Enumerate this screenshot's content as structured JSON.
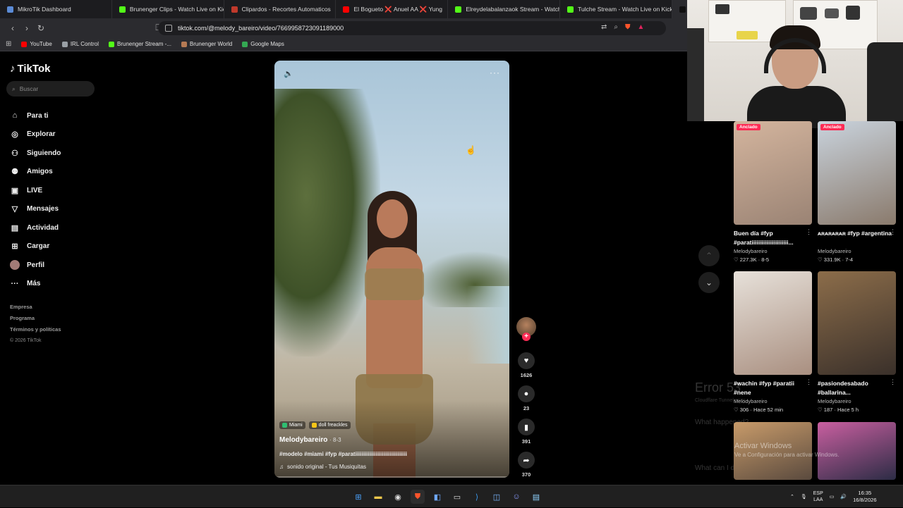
{
  "browser": {
    "tabs": [
      {
        "label": "MikroTik Dashboard",
        "color": "#5b8bd6"
      },
      {
        "label": "Brunenger Clips - Watch Live on Kick",
        "color": "#53fc18"
      },
      {
        "label": "Clipardos - Recortes Automaticos",
        "color": "#c0392b"
      },
      {
        "label": "El Bogueto ❌ Anuel AA ❌ Yung",
        "color": "#ff0000"
      },
      {
        "label": "Elreydelabalanzaok Stream - Watch",
        "color": "#53fc18"
      },
      {
        "label": "Tulche Stream - Watch Live on Kick",
        "color": "#53fc18"
      },
      {
        "label": "d",
        "color": "#111111"
      }
    ],
    "url": "tiktok.com/@melody_bareiro/video/7669958723091189000",
    "bookmarks": [
      {
        "label": "YouTube",
        "color": "#ff0000"
      },
      {
        "label": "IRL Control",
        "color": "#9aa0a6"
      },
      {
        "label": "Brunenger Stream -...",
        "color": "#53fc18"
      },
      {
        "label": "Brunenger World",
        "color": "#b57a54"
      },
      {
        "label": "Google Maps",
        "color": "#34a853"
      }
    ]
  },
  "tiktok": {
    "logo": "TikTok",
    "search_placeholder": "Buscar",
    "nav": [
      {
        "label": "Para ti",
        "icon": "home-icon",
        "glyph": "⌂"
      },
      {
        "label": "Explorar",
        "icon": "compass-icon",
        "glyph": "◎"
      },
      {
        "label": "Siguiendo",
        "icon": "following-icon",
        "glyph": "⚇"
      },
      {
        "label": "Amigos",
        "icon": "friends-icon",
        "glyph": "⚉"
      },
      {
        "label": "LIVE",
        "icon": "live-icon",
        "glyph": "▣"
      },
      {
        "label": "Mensajes",
        "icon": "messages-icon",
        "glyph": "▽"
      },
      {
        "label": "Actividad",
        "icon": "activity-icon",
        "glyph": "▤"
      },
      {
        "label": "Cargar",
        "icon": "upload-icon",
        "glyph": "⊞"
      },
      {
        "label": "Perfil",
        "icon": "avatar-icon",
        "glyph": ""
      },
      {
        "label": "Más",
        "icon": "more-icon",
        "glyph": "···"
      }
    ],
    "footer": [
      "Empresa",
      "Programa",
      "Términos y políticas"
    ],
    "copyright": "© 2026 TikTok",
    "video": {
      "tags": [
        {
          "label": "Miami",
          "color": "#2fbf71"
        },
        {
          "label": "doll freackles",
          "color": "#f5c518"
        }
      ],
      "author": "Melodybareiro",
      "date": "· 8-3",
      "description": "#modelo #miami #fyp #paratiiiiiiiiiiiiiiiiiiiiiiiiiiiiiiiii",
      "sound": "sonido original - Tus Musiquitas",
      "progress": 0.0
    },
    "actions": {
      "likes": "1626",
      "comments": "23",
      "saves": "391",
      "shares": "370"
    },
    "grid": [
      {
        "badge": "Anclado",
        "title": "Buen día #fyp #paratiiiiiiiiiiiiiiiiiiiiii...",
        "author": "Melodybareiro",
        "stats": "♡ 227.3K · 8-5",
        "c1": "#9a8374",
        "c2": "#d4b59e"
      },
      {
        "badge": "Anclado",
        "title": "ᴀʀᴀʀᴀʀᴀʀ #fyp #argentina",
        "author": "Melodybareiro",
        "stats": "♡ 331.9K · 7-4",
        "c1": "#8a7a6c",
        "c2": "#c9d3dd"
      },
      {
        "badge": "",
        "title": "#wachin #fyp #paratii #nene",
        "author": "Melodybareiro",
        "stats": "♡ 306 · Hace 52 min",
        "c1": "#a98f80",
        "c2": "#e7e1da"
      },
      {
        "badge": "",
        "title": "#pasiondesabado #ballarina...",
        "author": "Melodybareiro",
        "stats": "♡ 187 · Hace 5 h",
        "c1": "#3a302a",
        "c2": "#8c6d4a"
      },
      {
        "badge": "",
        "title": "",
        "author": "",
        "stats": "",
        "c1": "#5a4a3e",
        "c2": "#c89b6a"
      },
      {
        "badge": "",
        "title": "",
        "author": "",
        "stats": "",
        "c1": "#2c2c45",
        "c2": "#c95fa0"
      }
    ],
    "error_bg": {
      "title": "Error 53",
      "small": "Cloudflare Tunnel error",
      "what": "What happened?",
      "cando": "What can I do?"
    }
  },
  "watermark": {
    "title": "Activar Windows",
    "sub": "Ve a Configuración para activar Windows."
  },
  "taskbar": {
    "lang_top": "ESP",
    "lang_bottom": "LAA",
    "time": "16:35",
    "date": "16/8/2026"
  }
}
